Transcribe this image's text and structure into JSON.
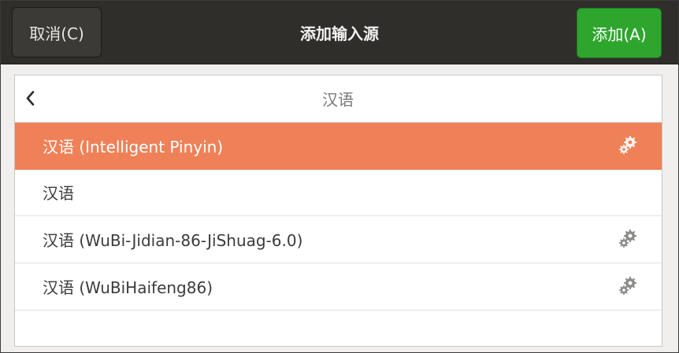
{
  "header": {
    "cancel_label": "取消(C)",
    "title": "添加输入源",
    "add_label": "添加(A)"
  },
  "list": {
    "title": "汉语",
    "items": [
      {
        "label": "汉语 (Intelligent Pinyin)",
        "selected": true,
        "has_settings": true
      },
      {
        "label": "汉语",
        "selected": false,
        "has_settings": false
      },
      {
        "label": "汉语 (WuBi-Jidian-86-JiShuag-6.0)",
        "selected": false,
        "has_settings": true
      },
      {
        "label": "汉语 (WuBiHaifeng86)",
        "selected": false,
        "has_settings": true
      }
    ]
  },
  "icons": {
    "back": "chevron-left-icon",
    "settings": "gears-icon"
  },
  "colors": {
    "header_bg": "#2f2e2b",
    "add_button": "#2ea62e",
    "selected_row": "#ef8158"
  }
}
